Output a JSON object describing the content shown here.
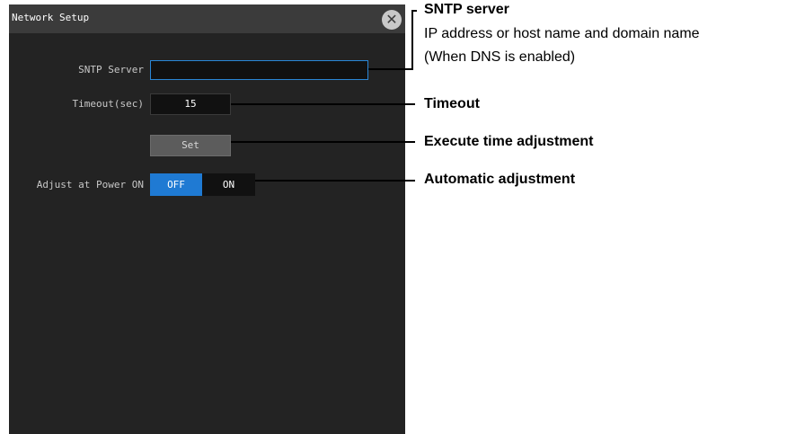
{
  "dialog": {
    "title": "Network Setup",
    "close_icon": "close-icon"
  },
  "fields": {
    "sntp_server": {
      "label": "SNTP Server",
      "value": ""
    },
    "timeout": {
      "label": "Timeout(sec)",
      "value": "15"
    },
    "set_button": {
      "label": "Set"
    },
    "adjust_power_on": {
      "label": "Adjust at Power ON",
      "off": "OFF",
      "on": "ON",
      "selected": "OFF"
    }
  },
  "callouts": {
    "sntp": {
      "title": "SNTP server",
      "line1": "IP address or host name and domain name",
      "line2": "(When DNS is enabled)"
    },
    "timeout": "Timeout",
    "execute": "Execute time adjustment",
    "automatic": "Automatic adjustment"
  },
  "colors": {
    "panel": "#232323",
    "titlebar": "#3b3b3b",
    "accent": "#1f7ad3",
    "input_border": "#2a86d6"
  }
}
